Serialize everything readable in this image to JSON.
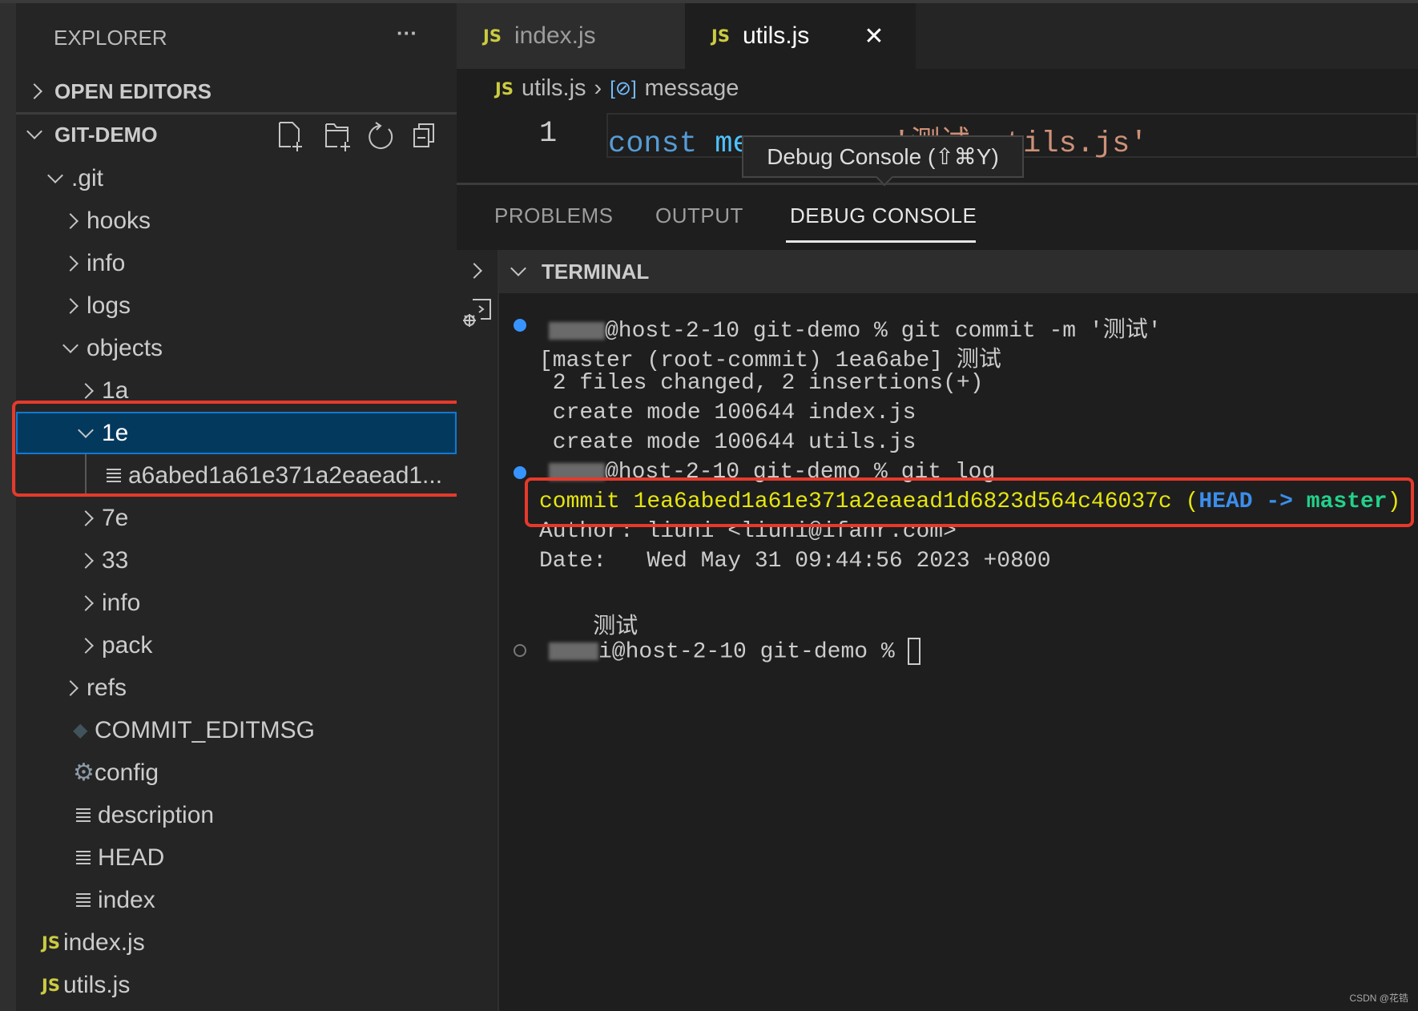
{
  "sidebar": {
    "title": "EXPLORER",
    "more": "···",
    "open_editors": "OPEN EDITORS",
    "root": "GIT-DEMO",
    "tree": [
      {
        "label": ".git",
        "depth": 0,
        "type": "folder",
        "open": true
      },
      {
        "label": "hooks",
        "depth": 1,
        "type": "folder",
        "open": false
      },
      {
        "label": "info",
        "depth": 1,
        "type": "folder",
        "open": false
      },
      {
        "label": "logs",
        "depth": 1,
        "type": "folder",
        "open": false
      },
      {
        "label": "objects",
        "depth": 1,
        "type": "folder",
        "open": true
      },
      {
        "label": "1a",
        "depth": 2,
        "type": "folder",
        "open": false
      },
      {
        "label": "1e",
        "depth": 2,
        "type": "folder",
        "open": true,
        "selected": true
      },
      {
        "label": "a6abed1a61e371a2eaead1...",
        "depth": 3,
        "type": "file-lines"
      },
      {
        "label": "7e",
        "depth": 2,
        "type": "folder",
        "open": false
      },
      {
        "label": "33",
        "depth": 2,
        "type": "folder",
        "open": false
      },
      {
        "label": "info",
        "depth": 2,
        "type": "folder",
        "open": false
      },
      {
        "label": "pack",
        "depth": 2,
        "type": "folder",
        "open": false
      },
      {
        "label": "refs",
        "depth": 1,
        "type": "folder",
        "open": false
      },
      {
        "label": "COMMIT_EDITMSG",
        "depth": 1,
        "type": "git-file"
      },
      {
        "label": "config",
        "depth": 1,
        "type": "gear-file"
      },
      {
        "label": "description",
        "depth": 1,
        "type": "file-lines"
      },
      {
        "label": "HEAD",
        "depth": 1,
        "type": "file-lines"
      },
      {
        "label": "index",
        "depth": 1,
        "type": "file-lines"
      },
      {
        "label": "index.js",
        "depth": 0,
        "type": "js"
      },
      {
        "label": "utils.js",
        "depth": 0,
        "type": "js"
      }
    ]
  },
  "tabs": [
    {
      "icon": "JS",
      "label": "index.js",
      "active": false
    },
    {
      "icon": "JS",
      "label": "utils.js",
      "active": true,
      "close": "✕"
    }
  ],
  "breadcrumb": {
    "file": "utils.js",
    "sep": "›",
    "symbol": "message"
  },
  "editor": {
    "line_number": "1",
    "keyword": "const",
    "identifier": "message",
    "op": "=",
    "string": "'测试 utils.js'"
  },
  "tooltip": "Debug Console (⇧⌘Y)",
  "panel": {
    "tabs": [
      "PROBLEMS",
      "OUTPUT",
      "DEBUG CONSOLE"
    ],
    "active": "DEBUG CONSOLE",
    "terminal_title": "TERMINAL"
  },
  "terminal": {
    "prompt1": "@host-2-10 git-demo % git commit -m '测试'",
    "out": [
      "[master (root-commit) 1ea6abe] 测试",
      " 2 files changed, 2 insertions(+)",
      " create mode 100644 index.js",
      " create mode 100644 utils.js"
    ],
    "prompt2": "@host-2-10 git-demo % git log",
    "commit_word": "commit 1ea6abed1a61e371a2eaead1d6823d564c46037c",
    "paren_open": " (",
    "head": "HEAD",
    "arrow": " ->",
    "branch": " master",
    "paren_close": ")",
    "author": "Author: liuni <liuni@ifanr.com>",
    "date": "Date:   Wed May 31 09:44:56 2023 +0800",
    "message": "    测试",
    "prompt3": "i@host-2-10 git-demo % "
  },
  "watermark": "CSDN @花锆",
  "colors": {
    "selection": "#04395e",
    "highlight_box": "#e53a2b",
    "commit_hash": "#e5e510",
    "head": "#3b8eea",
    "branch": "#23d18b"
  }
}
